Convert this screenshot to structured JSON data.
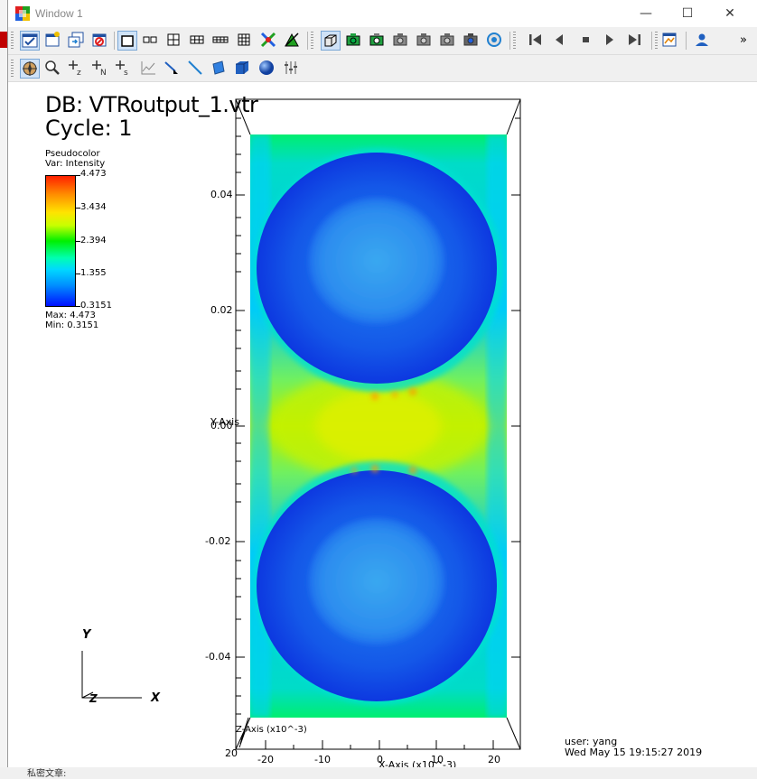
{
  "window": {
    "title": "Window 1",
    "controls": {
      "minimize": "—",
      "maximize": "☐",
      "close": "✕"
    }
  },
  "toolbar1": {
    "buttons": [
      {
        "name": "active-window-button",
        "icon": "checkmark-window-icon",
        "selected": true
      },
      {
        "name": "new-window-button",
        "icon": "new-window-icon"
      },
      {
        "name": "clone-window-button",
        "icon": "clone-window-icon"
      },
      {
        "name": "delete-window-button",
        "icon": "delete-window-icon"
      },
      {
        "name": "layout-1x1-button",
        "icon": "layout-1x1-icon",
        "selected": true
      },
      {
        "name": "layout-1x2-button",
        "icon": "layout-1x2-icon"
      },
      {
        "name": "layout-2x2-button",
        "icon": "layout-2x2-icon"
      },
      {
        "name": "layout-2x3-button",
        "icon": "layout-2x3-icon"
      },
      {
        "name": "layout-2x4-button",
        "icon": "layout-2x4-icon"
      },
      {
        "name": "layout-3x3-button",
        "icon": "layout-3x3-icon"
      },
      {
        "name": "lock-view-button",
        "icon": "lock-view-icon"
      },
      {
        "name": "lock-time-button",
        "icon": "lock-time-icon"
      },
      {
        "name": "view-3d-button",
        "icon": "cube-view-icon",
        "selected": true
      },
      {
        "name": "reset-view-button",
        "icon": "camera-green-icon"
      },
      {
        "name": "recenter-view-button",
        "icon": "camera-icon"
      },
      {
        "name": "undo-view-button",
        "icon": "camera-icon"
      },
      {
        "name": "invert-bg-button",
        "icon": "camera-icon"
      },
      {
        "name": "save-view-button",
        "icon": "camera-icon"
      },
      {
        "name": "choose-view-button",
        "icon": "camera-icon"
      },
      {
        "name": "spin-button",
        "icon": "spin-icon"
      },
      {
        "name": "rewind-button",
        "icon": "rewind-icon"
      },
      {
        "name": "step-back-button",
        "icon": "step-back-icon"
      },
      {
        "name": "stop-button",
        "icon": "stop-icon"
      },
      {
        "name": "play-button",
        "icon": "play-icon"
      },
      {
        "name": "step-forward-button",
        "icon": "step-forward-icon"
      },
      {
        "name": "annotation-button",
        "icon": "annotation-icon"
      },
      {
        "name": "user-button",
        "icon": "user-icon"
      }
    ],
    "overflow": "»"
  },
  "toolbar2": {
    "buttons": [
      {
        "name": "navigate-button",
        "icon": "compass-icon",
        "selected": true
      },
      {
        "name": "zoom-button",
        "icon": "magnifier-icon"
      },
      {
        "name": "zone-pick-button",
        "icon": "plus-z-icon"
      },
      {
        "name": "node-pick-button",
        "icon": "plus-n-icon"
      },
      {
        "name": "spreadsheet-pick-button",
        "icon": "plus-s-icon"
      },
      {
        "name": "curve-pick-button",
        "icon": "curve-icon"
      },
      {
        "name": "line-out-button",
        "icon": "pointer-icon"
      },
      {
        "name": "line-tool-button",
        "icon": "line-icon"
      },
      {
        "name": "plane-tool-button",
        "icon": "plane-icon"
      },
      {
        "name": "box-tool-button",
        "icon": "box-icon"
      },
      {
        "name": "sphere-tool-button",
        "icon": "sphere-icon"
      },
      {
        "name": "axis-restrict-button",
        "icon": "sliders-icon"
      }
    ]
  },
  "annotation": {
    "db": "DB: VTRoutput_1.vtr",
    "cycle": "Cycle: 1",
    "user": "user: yang",
    "date": "Wed May 15 19:15:27 2019"
  },
  "legend": {
    "type": "Pseudocolor",
    "var": "Var: Intensity",
    "ticks": [
      "4.473",
      "3.434",
      "2.394",
      "1.355",
      "0.3151"
    ],
    "max": "Max:  4.473",
    "min": "Min:  0.3151",
    "colors": [
      "#ff2000",
      "#ffe400",
      "#00f000",
      "#00d8ff",
      "#0010ff"
    ]
  },
  "axes": {
    "y_title": "Y-Axis",
    "x_title": "X-Axis (x10^-3)",
    "z_title": "Z-Axis (x10^-3)",
    "y_ticks": [
      "0.04",
      "0.02",
      "0.00",
      "-0.02",
      "-0.04"
    ],
    "x_ticks": [
      "-20",
      "-10",
      "0",
      "10",
      "20"
    ],
    "z_corner": "20"
  },
  "triad": {
    "y": "Y",
    "x": "X",
    "z": "Z"
  },
  "taskbar_fragment": "私密文章:"
}
